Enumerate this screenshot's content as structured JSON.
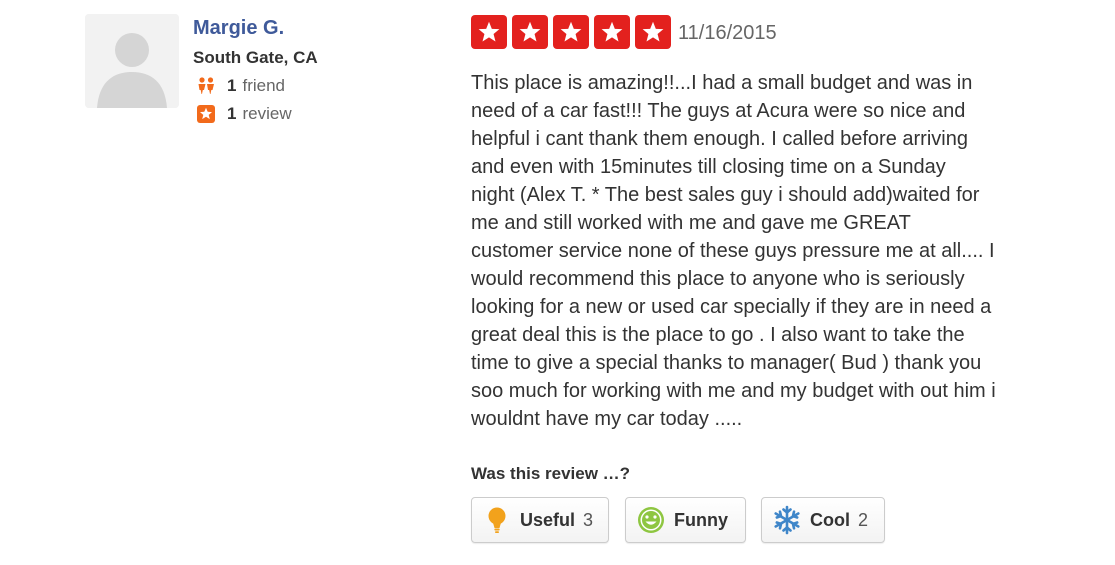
{
  "user": {
    "name": "Margie G.",
    "location": "South Gate, CA",
    "friends_count": "1",
    "friends_label": "friend",
    "reviews_count": "1",
    "reviews_label": "review"
  },
  "review": {
    "rating": 5,
    "max_rating": 5,
    "date": "11/16/2015",
    "text": "This place is amazing!!...I had a small budget and was in\nneed of a car fast!!! The guys at Acura were so nice and\nhelpful i cant thank them enough. I called before arriving\nand even with 15minutes till closing time on a Sunday\n night  (Alex T. * The best sales guy i should add)waited for\nme and  still worked with me and gave me  GREAT\ncustomer service none of these guys pressure me at all.... I\nwould recommend this place to anyone who is seriously\nlooking for a new or used car specially if they are in need a\ngreat deal  this is the place to go . I also want to take the\ntime to give a special thanks to manager( Bud ) thank you\nsoo much for working with me and my budget with out him i\nwouldnt have my car today ....."
  },
  "votes": {
    "prompt": "Was this review …?",
    "useful": {
      "label": "Useful",
      "count": "3",
      "icon": "lightbulb-icon"
    },
    "funny": {
      "label": "Funny",
      "count": "",
      "icon": "smiley-icon"
    },
    "cool": {
      "label": "Cool",
      "count": "2",
      "icon": "snowflake-icon"
    }
  },
  "colors": {
    "star_red": "#e3211e",
    "user_link": "#3f5a9a",
    "useful_icon": "#f2a21c",
    "funny_icon": "#8ec641",
    "cool_icon": "#3f86c9",
    "friend_icon": "#f26a1b"
  }
}
